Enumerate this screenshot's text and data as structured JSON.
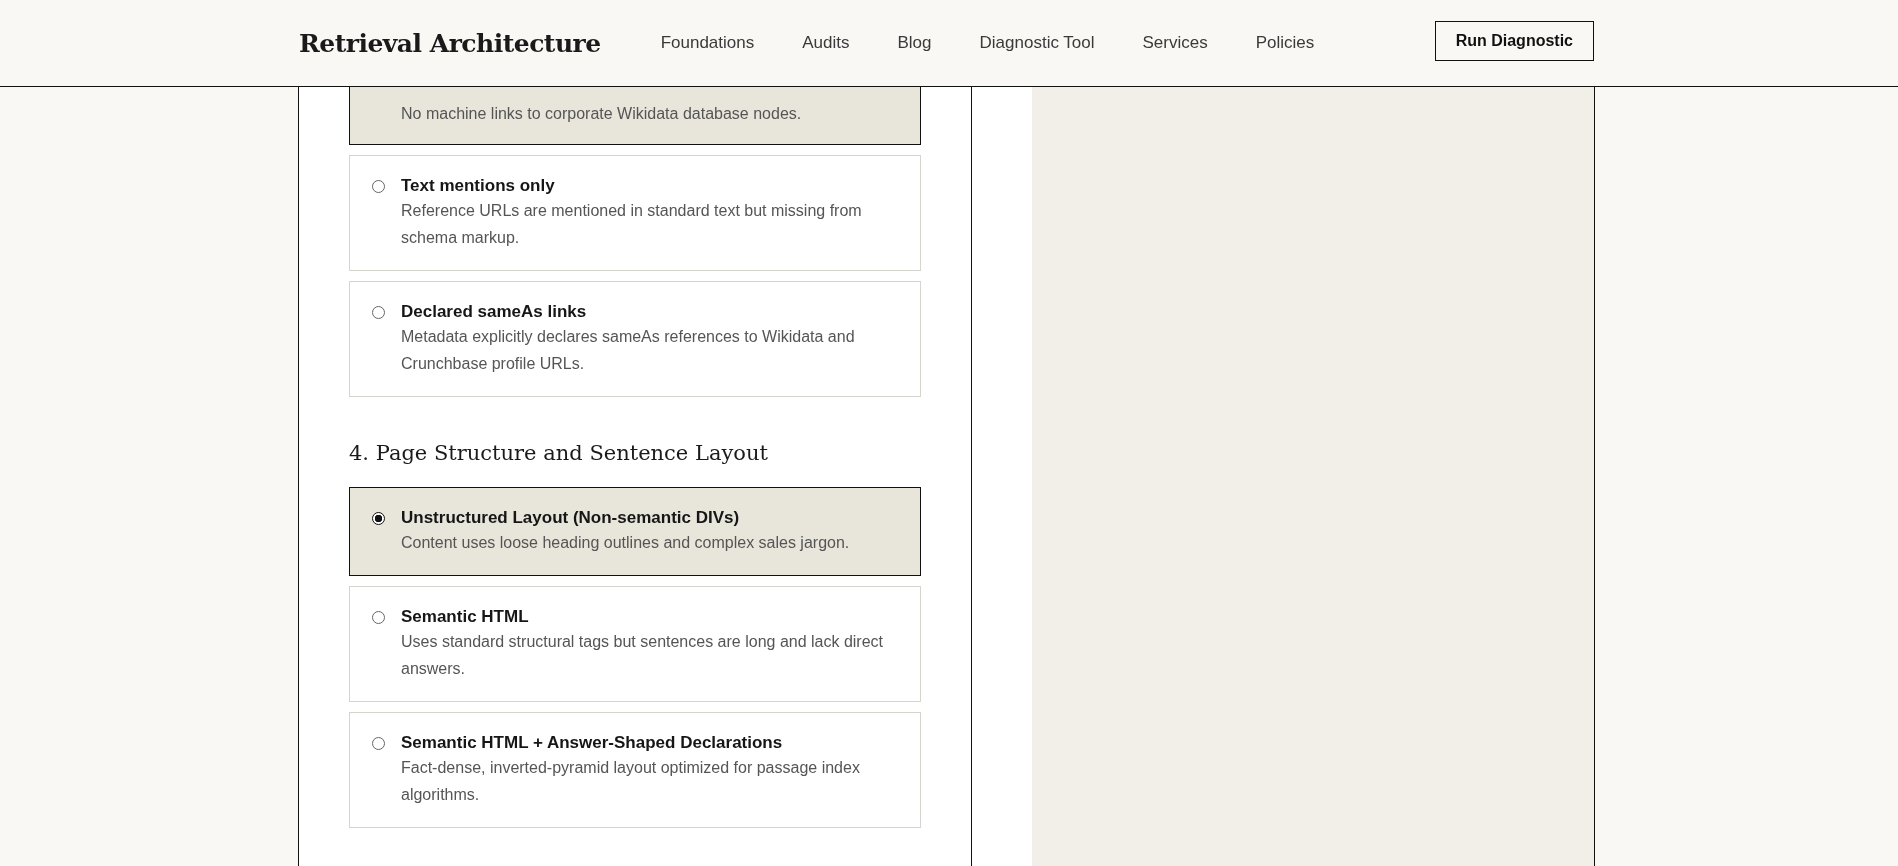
{
  "header": {
    "logo": "Retrieval Architecture",
    "nav": [
      {
        "label": "Foundations"
      },
      {
        "label": "Audits"
      },
      {
        "label": "Blog"
      },
      {
        "label": "Diagnostic Tool"
      },
      {
        "label": "Services"
      },
      {
        "label": "Policies"
      }
    ],
    "cta": "Run Diagnostic"
  },
  "groups": [
    {
      "options": [
        {
          "description": "No machine links to corporate Wikidata database nodes.",
          "selected": true
        },
        {
          "title": "Text mentions only",
          "description": "Reference URLs are mentioned in standard text but missing from schema markup.",
          "selected": false
        },
        {
          "title": "Declared sameAs links",
          "description": "Metadata explicitly declares sameAs references to Wikidata and Crunchbase profile URLs.",
          "selected": false
        }
      ]
    },
    {
      "heading": "4. Page Structure and Sentence Layout",
      "options": [
        {
          "title": "Unstructured Layout (Non-semantic DIVs)",
          "description": "Content uses loose heading outlines and complex sales jargon.",
          "selected": true
        },
        {
          "title": "Semantic HTML",
          "description": "Uses standard structural tags but sentences are long and lack direct answers.",
          "selected": false
        },
        {
          "title": "Semantic HTML + Answer-Shaped Declarations",
          "description": "Fact-dense, inverted-pyramid layout optimized for passage index algorithms.",
          "selected": false
        }
      ]
    }
  ]
}
